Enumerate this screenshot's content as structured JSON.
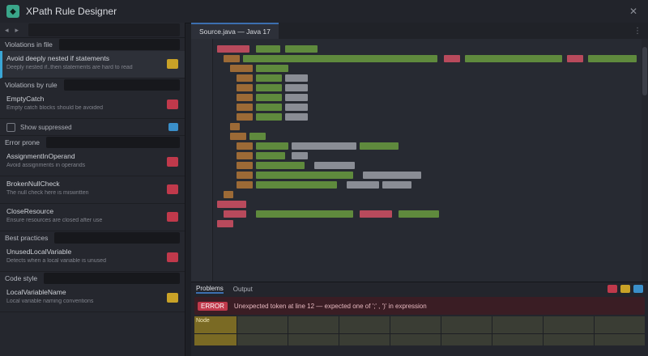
{
  "window": {
    "title": "XPath Rule Designer"
  },
  "left_panel": {
    "toolbar": {
      "btn_left": "◂",
      "btn_right": "▸"
    },
    "sections": [
      {
        "title": "Violations in file",
        "items": [
          {
            "name": "Avoid deeply nested if statements",
            "desc": "Deeply nested if..then statements are hard to read",
            "severity": "yellow",
            "selected": true
          }
        ]
      },
      {
        "title": "Violations by rule",
        "items": [
          {
            "name": "EmptyCatch",
            "desc": "Empty catch blocks should be avoided",
            "severity": "red",
            "selected": false
          }
        ],
        "checkrow": {
          "label": "Show suppressed",
          "severity": "blue"
        }
      },
      {
        "title": "Error prone",
        "items": [
          {
            "name": "AssignmentInOperand",
            "desc": "Avoid assignments in operands",
            "severity": "red",
            "selected": false
          },
          {
            "name": "BrokenNullCheck",
            "desc": "The null check here is miswritten",
            "severity": "red",
            "selected": false
          },
          {
            "name": "CloseResource",
            "desc": "Ensure resources are closed after use",
            "severity": "red",
            "selected": false
          }
        ]
      },
      {
        "title": "Best practices",
        "items": [
          {
            "name": "UnusedLocalVariable",
            "desc": "Detects when a local variable is unused",
            "severity": "red",
            "selected": false
          }
        ]
      },
      {
        "title": "Code style",
        "items": [
          {
            "name": "LocalVariableName",
            "desc": "Local variable naming conventions",
            "severity": "yellow",
            "selected": false
          }
        ]
      }
    ]
  },
  "editor": {
    "tabs": [
      {
        "label": "Source.java — Java 17",
        "active": true
      }
    ],
    "menu_icon": "⋮"
  },
  "results": {
    "tabs": [
      {
        "label": "Problems",
        "active": true
      },
      {
        "label": "Output",
        "active": false
      }
    ],
    "error": {
      "badge": "ERROR",
      "message": "Unexpected token at line 12 — expected one of ';' , ')' in expression"
    },
    "grid": {
      "head": "Node",
      "cells": [
        "",
        "",
        "",
        "",
        "",
        "",
        "",
        ""
      ]
    },
    "colors": {
      "red": "#c0394b",
      "yellow": "#c9a227",
      "blue": "#3a8fc9"
    }
  }
}
